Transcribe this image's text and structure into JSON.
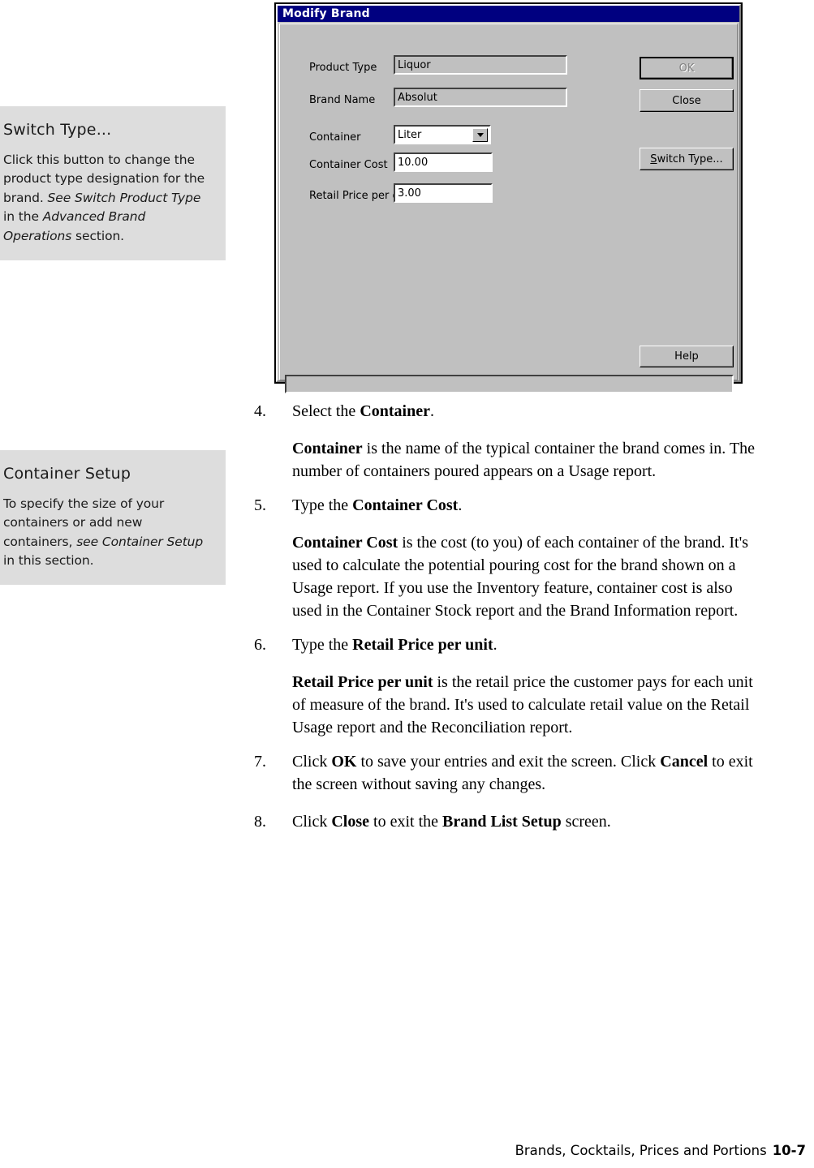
{
  "dialog": {
    "title": "Modify Brand",
    "fields": [
      {
        "label": "Product Type",
        "value": "Liquor",
        "type": "text-readonly"
      },
      {
        "label": "Brand Name",
        "value": "Absolut",
        "type": "text-readonly"
      },
      {
        "label": "Container",
        "value": "Liter",
        "type": "combobox"
      },
      {
        "label": "Container Cost",
        "value": "10.00",
        "type": "text"
      },
      {
        "label": "Retail Price per oz",
        "value": "3.00",
        "type": "text"
      }
    ],
    "buttons": {
      "ok": "OK",
      "close": "Close",
      "switch_type_accel": "S",
      "switch_type_rest": "witch Type...",
      "help": "Help"
    },
    "statusbar_text": "",
    "colors": {
      "titlebar": "#000080",
      "face": "#c0c0c0",
      "disabled_text": "#808080"
    }
  },
  "callouts": [
    {
      "title": "Switch Type...",
      "body_parts": [
        {
          "text": "Click this button to change the product type designation for the brand. ",
          "italic": false
        },
        {
          "text": "See Switch Product Type",
          "italic": true
        },
        {
          "text": " in the ",
          "italic": false
        },
        {
          "text": "Advanced Brand Operations",
          "italic": true
        },
        {
          "text": " section.",
          "italic": false
        }
      ],
      "background": "#dddddd"
    },
    {
      "title": "Container Setup",
      "body_parts": [
        {
          "text": "To specify the size of your containers or add new containers, ",
          "italic": false
        },
        {
          "text": "see Container Setup",
          "italic": true
        },
        {
          "text": " in this section.",
          "italic": false
        }
      ],
      "background": "#dddddd"
    }
  ],
  "steps": [
    {
      "number": "4.",
      "parts": [
        {
          "text": "Select the ",
          "bold": false
        },
        {
          "text": "Container",
          "bold": true
        },
        {
          "text": ".",
          "bold": false
        }
      ]
    },
    {
      "number": "5.",
      "parts": [
        {
          "text": "Type the ",
          "bold": false
        },
        {
          "text": "Container Cost",
          "bold": true
        },
        {
          "text": ".",
          "bold": false
        }
      ]
    },
    {
      "number": "6.",
      "parts": [
        {
          "text": "Type the ",
          "bold": false
        },
        {
          "text": "Retail Price per unit",
          "bold": true
        },
        {
          "text": ".",
          "bold": false
        }
      ]
    },
    {
      "number": "7.",
      "parts": [
        {
          "text": "Click ",
          "bold": false
        },
        {
          "text": "OK",
          "bold": true
        },
        {
          "text": " to save your entries and exit the screen. Click ",
          "bold": false
        },
        {
          "text": "Cancel",
          "bold": true
        },
        {
          "text": " to exit the screen without saving any changes.",
          "bold": false
        }
      ]
    },
    {
      "number": "8.",
      "parts": [
        {
          "text": "Click ",
          "bold": false
        },
        {
          "text": "Close",
          "bold": true
        },
        {
          "text": " to exit the ",
          "bold": false
        },
        {
          "text": "Brand List Setup",
          "bold": true
        },
        {
          "text": " screen.",
          "bold": false
        }
      ]
    }
  ],
  "paragraphs": [
    {
      "id": "container-desc",
      "parts": [
        {
          "text": "Container",
          "bold": true
        },
        {
          "text": " is the name of the typical container the brand comes in. The number of containers poured appears on a Usage report.",
          "bold": false
        }
      ]
    },
    {
      "id": "container-cost-desc",
      "parts": [
        {
          "text": "Container Cost",
          "bold": true
        },
        {
          "text": " is the cost (to you) of each container of the brand. It's used to calculate the potential pouring cost for the brand shown on a Usage report. If you use the Inventory feature, container cost is also used in the Container Stock report and the Brand Information report.",
          "bold": false
        }
      ]
    },
    {
      "id": "retail-price-desc",
      "parts": [
        {
          "text": "Retail Price per unit",
          "bold": true
        },
        {
          "text": " is the retail price the customer pays for each unit of measure of the brand. It's used to calculate retail value on the Retail Usage report and the Reconciliation report.",
          "bold": false
        }
      ]
    }
  ],
  "footer": {
    "chapter": "Brands, Cocktails, Prices and Portions",
    "page": "10-7"
  }
}
